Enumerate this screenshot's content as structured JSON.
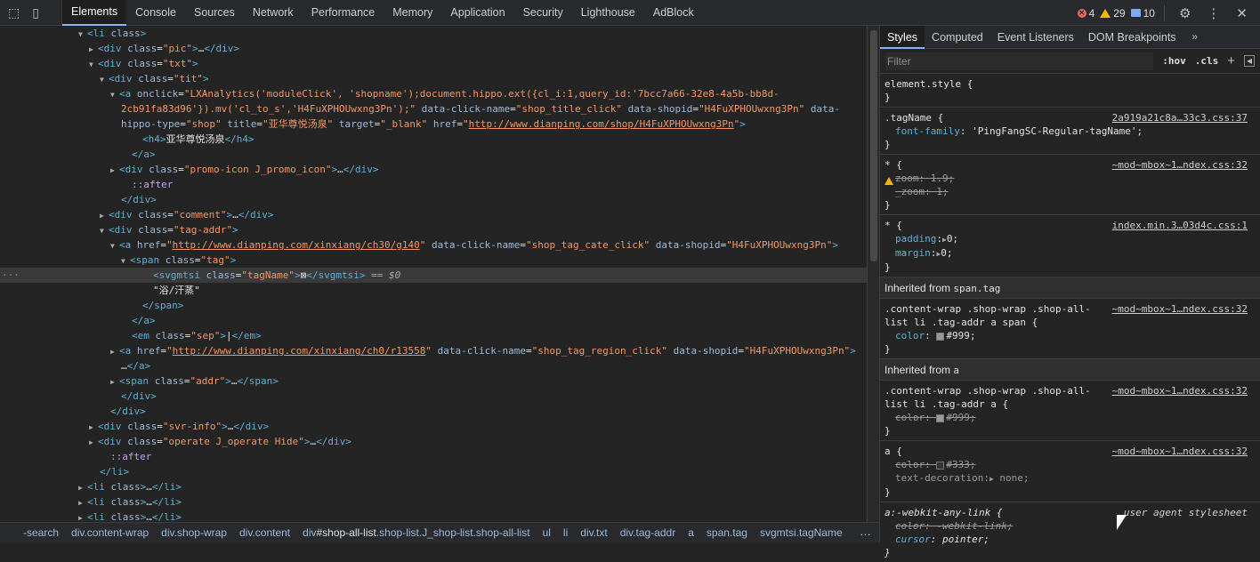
{
  "toolbar": {
    "tabs": [
      "Elements",
      "Console",
      "Sources",
      "Network",
      "Performance",
      "Memory",
      "Application",
      "Security",
      "Lighthouse",
      "AdBlock"
    ],
    "errors": "4",
    "warnings": "29",
    "messages": "10"
  },
  "dom": {
    "lines": [
      {
        "i": 100,
        "a": "▼",
        "h": "<span class='tg'>&lt;li</span> <span class='at'>class</span><span class='tg'>&gt;</span>"
      },
      {
        "i": 112,
        "a": "▶",
        "h": "<span class='tg'>&lt;div</span> <span class='at'>class</span>=<span class='av'>\"pic\"</span><span class='tg'>&gt;</span>…<span class='tg'>&lt;/div&gt;</span>"
      },
      {
        "i": 112,
        "a": "▼",
        "h": "<span class='tg'>&lt;div</span> <span class='at'>class</span>=<span class='av'>\"txt\"</span><span class='tg'>&gt;</span>"
      },
      {
        "i": 124,
        "a": "▼",
        "h": "<span class='tg'>&lt;div</span> <span class='at'>class</span>=<span class='av'>\"tit\"</span><span class='tg'>&gt;</span>"
      },
      {
        "i": 136,
        "a": "▼",
        "h": "<span class='tg'>&lt;a</span> <span class='at'>onclick</span>=<span class='av'>\"LXAnalytics('moduleClick', 'shopname');document.hippo.ext({cl_i:1,query_id:'7bcc7a66-32e8-4a5b-bb8d-</span>"
      },
      {
        "i": 136,
        "a": "",
        "h": "<span class='av'>2cb91fa83d96'}).mv('cl_to_s','H4FuXPHOUwxng3Pn');\"</span> <span class='at'>data-click-name</span>=<span class='av'>\"shop_title_click\"</span> <span class='at'>data-shopid</span>=<span class='av'>\"H4FuXPHOUwxng3Pn\"</span> <span class='at'>data-</span>"
      },
      {
        "i": 136,
        "a": "",
        "h": "<span class='at'>hippo-type</span>=<span class='av'>\"shop\"</span> <span class='at'>title</span>=<span class='av'>\"亚华尊悦汤泉\"</span> <span class='at'>target</span>=<span class='av'>\"_blank\"</span> <span class='at'>href</span>=<span class='av'>\"</span><span class='lk'>http://www.dianping.com/shop/H4FuXPHOUwxng3Pn</span><span class='av'>\"</span><span class='tg'>&gt;</span>"
      },
      {
        "i": 160,
        "a": "",
        "h": "<span class='tg'>&lt;h4&gt;</span><span class='tx'>亚华尊悦汤泉</span><span class='tg'>&lt;/h4&gt;</span>"
      },
      {
        "i": 148,
        "a": "",
        "h": "<span class='tg'>&lt;/a&gt;</span>"
      },
      {
        "i": 136,
        "a": "▶",
        "h": "<span class='tg'>&lt;div</span> <span class='at'>class</span>=<span class='av'>\"promo-icon J_promo_icon\"</span><span class='tg'>&gt;</span>…<span class='tg'>&lt;/div&gt;</span>"
      },
      {
        "i": 148,
        "a": "",
        "h": "<span class='pseudo'>::after</span>"
      },
      {
        "i": 136,
        "a": "",
        "h": "<span class='tg'>&lt;/div&gt;</span>"
      },
      {
        "i": 124,
        "a": "▶",
        "h": "<span class='tg'>&lt;div</span> <span class='at'>class</span>=<span class='av'>\"comment\"</span><span class='tg'>&gt;</span>…<span class='tg'>&lt;/div&gt;</span>"
      },
      {
        "i": 124,
        "a": "▼",
        "h": "<span class='tg'>&lt;div</span> <span class='at'>class</span>=<span class='av'>\"tag-addr\"</span><span class='tg'>&gt;</span>"
      },
      {
        "i": 136,
        "a": "▼",
        "h": "<span class='tg'>&lt;a</span> <span class='at'>href</span>=<span class='av'>\"</span><span class='lk'>http://www.dianping.com/xinxiang/ch30/g140</span><span class='av'>\"</span> <span class='at'>data-click-name</span>=<span class='av'>\"shop_tag_cate_click\"</span> <span class='at'>data-shopid</span>=<span class='av'>\"H4FuXPHOUwxng3Pn\"</span><span class='tg'>&gt;</span>"
      },
      {
        "i": 148,
        "a": "▼",
        "h": "<span class='tg'>&lt;span</span> <span class='at'>class</span>=<span class='av'>\"tag\"</span><span class='tg'>&gt;</span>"
      },
      {
        "i": 172,
        "a": "",
        "sel": true,
        "h": "<span class='tg'>&lt;svgmtsi</span> <span class='at'>class</span>=<span class='av'>\"tagName\"</span><span class='tg'>&gt;</span><span class='tx'>⊠</span><span class='tg'>&lt;/svgmtsi&gt;</span> <span class='pc'>== <i>$0</i></span>"
      },
      {
        "i": 172,
        "a": "",
        "h": "<span class='tx'>\"浴/汗蒸\"</span>"
      },
      {
        "i": 160,
        "a": "",
        "h": "<span class='tg'>&lt;/span&gt;</span>"
      },
      {
        "i": 148,
        "a": "",
        "h": "<span class='tg'>&lt;/a&gt;</span>"
      },
      {
        "i": 148,
        "a": "",
        "h": "<span class='tg'>&lt;em</span> <span class='at'>class</span>=<span class='av'>\"sep\"</span><span class='tg'>&gt;</span><span class='tx'>|</span><span class='tg'>&lt;/em&gt;</span>"
      },
      {
        "i": 136,
        "a": "▶",
        "h": "<span class='tg'>&lt;a</span> <span class='at'>href</span>=<span class='av'>\"</span><span class='lk'>http://www.dianping.com/xinxiang/ch0/r13558</span><span class='av'>\"</span> <span class='at'>data-click-name</span>=<span class='av'>\"shop_tag_region_click\"</span> <span class='at'>data-shopid</span>=<span class='av'>\"H4FuXPHOUwxng3Pn\"</span><span class='tg'>&gt;</span>"
      },
      {
        "i": 136,
        "a": "",
        "h": "…<span class='tg'>&lt;/a&gt;</span>"
      },
      {
        "i": 136,
        "a": "▶",
        "h": "<span class='tg'>&lt;span</span> <span class='at'>class</span>=<span class='av'>\"addr\"</span><span class='tg'>&gt;</span>…<span class='tg'>&lt;/span&gt;</span>"
      },
      {
        "i": 136,
        "a": "",
        "h": "<span class='tg'>&lt;/div&gt;</span>"
      },
      {
        "i": 124,
        "a": "",
        "h": "<span class='tg'>&lt;/div&gt;</span>"
      },
      {
        "i": 112,
        "a": "▶",
        "h": "<span class='tg'>&lt;div</span> <span class='at'>class</span>=<span class='av'>\"svr-info\"</span><span class='tg'>&gt;</span>…<span class='tg'>&lt;/div&gt;</span>"
      },
      {
        "i": 112,
        "a": "▶",
        "h": "<span class='tg'>&lt;div</span> <span class='at'>class</span>=<span class='av'>\"operate J_operate Hide\"</span><span class='tg'>&gt;</span>…<span class='tg'>&lt;/div&gt;</span>"
      },
      {
        "i": 124,
        "a": "",
        "h": "<span class='pseudo'>::after</span>"
      },
      {
        "i": 112,
        "a": "",
        "h": "<span class='tg'>&lt;/li&gt;</span>"
      },
      {
        "i": 100,
        "a": "▶",
        "h": "<span class='tg'>&lt;li</span> <span class='at'>class</span><span class='tg'>&gt;</span>…<span class='tg'>&lt;/li&gt;</span>"
      },
      {
        "i": 100,
        "a": "▶",
        "h": "<span class='tg'>&lt;li</span> <span class='at'>class</span><span class='tg'>&gt;</span>…<span class='tg'>&lt;/li&gt;</span>"
      },
      {
        "i": 100,
        "a": "▶",
        "h": "<span class='tg'>&lt;li</span> <span class='at'>class</span><span class='tg'>&gt;</span>…<span class='tg'>&lt;/li&gt;</span>"
      }
    ]
  },
  "breadcrumbs": [
    "-search",
    "div.content-wrap",
    "div.shop-wrap",
    "div.content",
    "div#shop-all-list.shop-list.J_shop-list.shop-all-list",
    "ul",
    "li",
    "div.txt",
    "div.tag-addr",
    "a",
    "span.tag",
    "svgmtsi.tagName"
  ],
  "styles": {
    "tabs": [
      "Styles",
      "Computed",
      "Event Listeners",
      "DOM Breakpoints"
    ],
    "filter_placeholder": "Filter",
    "hov": ":hov",
    "cls": ".cls",
    "element_style": "element.style {",
    "r1_sel": ".tagName {",
    "r1_src": "2a919a21c8a…33c3.css:37",
    "r1_p": "font-family",
    "r1_v": "'PingFangSC-Regular-tagName';",
    "r2_sel": "* {",
    "r2_src": "~mod~mbox~1…ndex.css:32",
    "r2_p1": "zoom",
    "r2_v1": "1.9;",
    "r2_p2": "_zoom",
    "r2_v2": "1;",
    "r3_sel": "* {",
    "r3_src": "index.min.3…03d4c.css:1",
    "r3_p1": "padding",
    "r3_v1": "0;",
    "r3_p2": "margin",
    "r3_v2": "0;",
    "inh1": "Inherited from",
    "inh1_el": "span.tag",
    "r4_sel1": ".content-wrap .shop-wrap .shop-all-",
    "r4_sel2": "list li .tag-addr a span {",
    "r4_src": "~mod~mbox~1…ndex.css:32",
    "r4_p": "color",
    "r4_v": "#999;",
    "inh2": "Inherited from",
    "inh2_el": "a",
    "r5_sel1": ".content-wrap .shop-wrap .shop-all-",
    "r5_sel2": "list li .tag-addr a {",
    "r5_src": "~mod~mbox~1…ndex.css:32",
    "r5_p": "color",
    "r5_v": "#999;",
    "r6_sel": "a {",
    "r6_src": "~mod~mbox~1…ndex.css:32",
    "r6_p1": "color",
    "r6_v1": "#333;",
    "r6_p2": "text-decoration",
    "r6_v2": "none;",
    "r7_sel": "a:-webkit-any-link {",
    "r7_src": "user agent stylesheet",
    "r7_p1": "color",
    "r7_v1": "-webkit-link;",
    "r7_p2": "cursor",
    "r7_v2": "pointer;",
    "close": "}"
  },
  "colors": {
    "accent": "#8ab4f8",
    "swatch999": "#999999",
    "swatch333": "#333333"
  }
}
